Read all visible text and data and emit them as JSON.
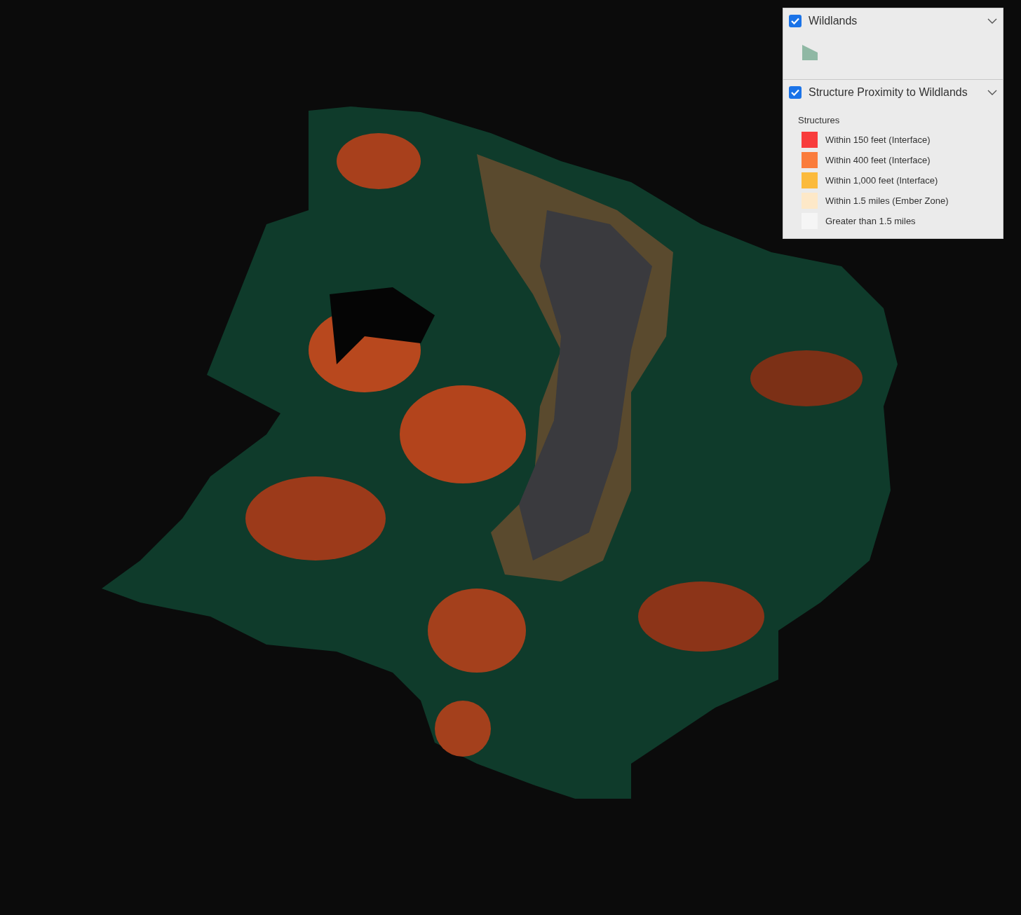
{
  "layers": [
    {
      "title": "Wildlands",
      "checked": true,
      "expanded": true,
      "kind": "symbol",
      "color": "#8fb8a4"
    },
    {
      "title": "Structure Proximity to Wildlands",
      "checked": true,
      "expanded": true,
      "kind": "classes",
      "group_label": "Structures",
      "items": [
        {
          "label": "Within 150 feet (Interface)",
          "color": "#f83c3c"
        },
        {
          "label": "Within 400 feet (Interface)",
          "color": "#fa7c3c"
        },
        {
          "label": "Within 1,000 feet (Interface)",
          "color": "#fbba3c"
        },
        {
          "label": "Within 1.5 miles (Ember Zone)",
          "color": "#fde8c8"
        },
        {
          "label": "Greater than 1.5 miles",
          "color": "#f5f5f5"
        }
      ]
    }
  ]
}
